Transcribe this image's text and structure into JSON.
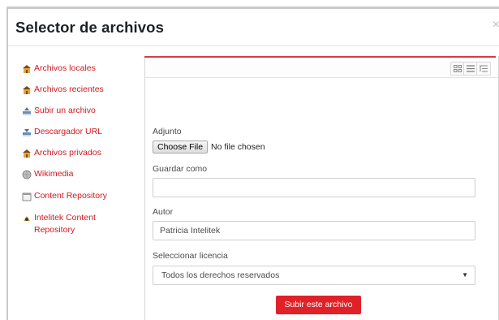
{
  "dialog": {
    "title": "Selector de archivos",
    "close_symbol": "×"
  },
  "sidebar": {
    "items": [
      {
        "label": "Archivos locales",
        "icon": "repository-icon"
      },
      {
        "label": "Archivos recientes",
        "icon": "repository-icon"
      },
      {
        "label": "Subir un archivo",
        "icon": "upload-icon"
      },
      {
        "label": "Descargador URL",
        "icon": "url-download-icon"
      },
      {
        "label": "Archivos privados",
        "icon": "repository-icon"
      },
      {
        "label": "Wikimedia",
        "icon": "wikimedia-icon"
      },
      {
        "label": "Content Repository",
        "icon": "content-repository-icon"
      },
      {
        "label": "Intelitek Content Repository",
        "icon": "intelitek-icon"
      }
    ]
  },
  "upload_form": {
    "attachment_label": "Adjunto",
    "choose_file_button": "Choose File",
    "file_status": "No file chosen",
    "save_as_label": "Guardar como",
    "save_as_value": "",
    "author_label": "Autor",
    "author_value": "Patricia Intelitek",
    "license_label": "Seleccionar licencia",
    "license_value": "Todos los derechos reservados",
    "submit_button": "Subir este archivo"
  },
  "colors": {
    "accent": "#d0191f",
    "submit_bg": "#e02128",
    "panel_top_border": "#d93a4c"
  }
}
